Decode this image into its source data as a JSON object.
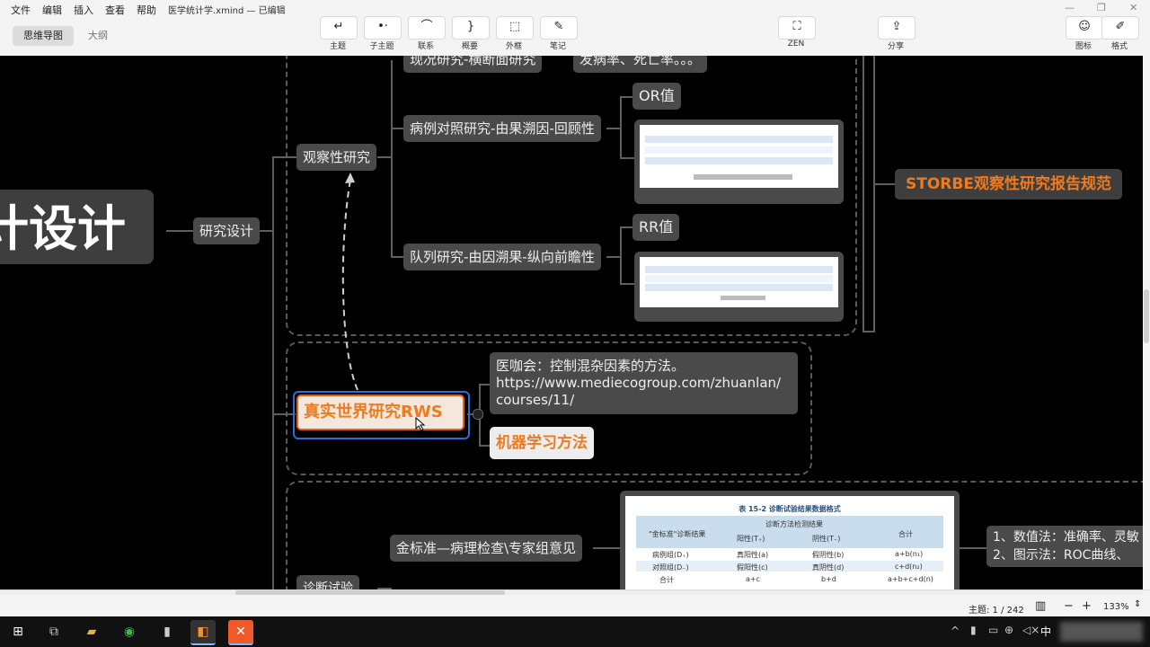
{
  "menu": [
    "文件",
    "编辑",
    "插入",
    "查看",
    "帮助"
  ],
  "title": "医学统计学.xmind — 已编辑",
  "view_tabs": [
    "思维导图",
    "大纲"
  ],
  "toolbar": [
    {
      "label": "主题",
      "icon": "topic-icon",
      "glyph": "↵"
    },
    {
      "label": "子主题",
      "icon": "subtopic-icon",
      "glyph": "•·"
    },
    {
      "label": "联系",
      "icon": "relationship-icon",
      "glyph": "⌒"
    },
    {
      "label": "概要",
      "icon": "summary-icon",
      "glyph": "}"
    },
    {
      "label": "外框",
      "icon": "boundary-icon",
      "glyph": "⬚"
    },
    {
      "label": "笔记",
      "icon": "note-icon",
      "glyph": "✎"
    }
  ],
  "zen": {
    "label": "ZEN",
    "glyph": "⛶"
  },
  "share": {
    "label": "分享",
    "glyph": "⇪"
  },
  "right_tools": [
    {
      "label": "图标",
      "icon": "emoji-icon",
      "glyph": "☺"
    },
    {
      "label": "格式",
      "icon": "format-brush-icon",
      "glyph": "✐"
    }
  ],
  "mindmap": {
    "root": "统计设计",
    "research_design": "研究设计",
    "observational": "观察性研究",
    "cross_sectional": "现况研究-横断面研究",
    "cross_sectional_note": "发病率、死亡率。。。",
    "case_control": "病例对照研究-由果溯因-回顾性",
    "or_value": "OR值",
    "cohort": "队列研究-由因溯果-纵向前瞻性",
    "rr_value": "RR值",
    "storbe": "STORBE观察性研究报告规范",
    "rws": "真实世界研究RWS",
    "rws_note": "医咖会：控制混杂因素的方法。\nhttps://www.mediecogroup.com/zhuanlan/\ncourses/11/",
    "ml": "机器学习方法",
    "diag": "诊断试验",
    "gold": "金标准—病理检查\\专家组意见",
    "eval": "1、数值法：准确率、灵敏\n2、图示法：ROC曲线、"
  },
  "diag_table": {
    "caption": "表 15-2   诊断试验结果数据格式",
    "col_gold": "\"金标准\"诊断结果",
    "col_method": "诊断方法检测结果",
    "col_pos": "阳性(T₊)",
    "col_neg": "阴性(T₋)",
    "col_total": "合计",
    "rows": [
      [
        "病例组(D₊)",
        "真阳性(a)",
        "假阴性(b)",
        "a+b(n₁)"
      ],
      [
        "对照组(D₋)",
        "假阳性(c)",
        "真阴性(d)",
        "c+d(n₂)"
      ],
      [
        "合计",
        "a+c",
        "b+d",
        "a+b+c+d(n)"
      ]
    ]
  },
  "status": {
    "topic_count": "主题: 1 / 242",
    "zoom": "133%"
  },
  "tray": {
    "ime": "中"
  },
  "colors": {
    "orange": "#f07a1e",
    "node": "#4a4a4a",
    "canvas": "#000000"
  }
}
